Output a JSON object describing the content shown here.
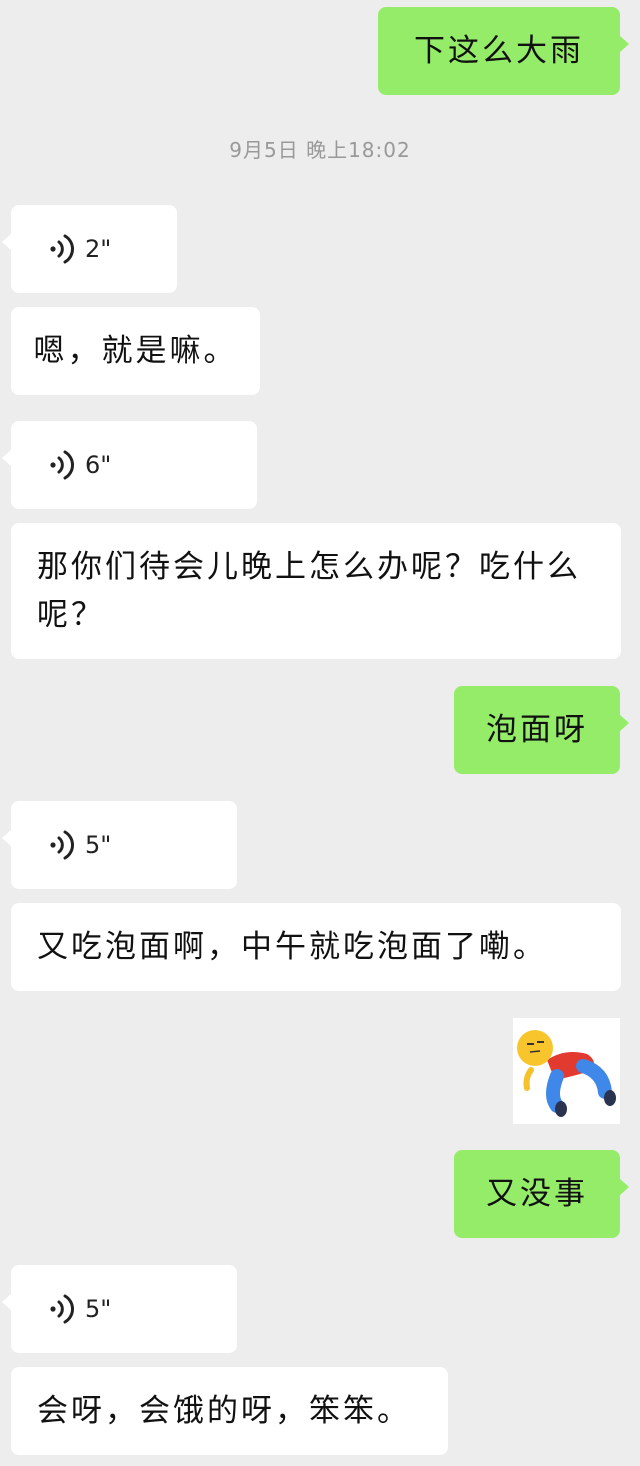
{
  "messages": [
    {
      "side": "right",
      "type": "text",
      "text": "下这么大雨"
    },
    {
      "type": "timestamp",
      "text": "9月5日 晚上18:02"
    },
    {
      "side": "left",
      "type": "voice",
      "duration": "2\""
    },
    {
      "side": "left",
      "type": "text",
      "text": "嗯，就是嘛。"
    },
    {
      "side": "left",
      "type": "voice",
      "duration": "6\""
    },
    {
      "side": "left",
      "type": "text",
      "text": "那你们待会儿晚上怎么办呢？吃什么呢？"
    },
    {
      "side": "right",
      "type": "text",
      "text": "泡面呀"
    },
    {
      "side": "left",
      "type": "voice",
      "duration": "5\""
    },
    {
      "side": "left",
      "type": "text",
      "text": "又吃泡面啊，中午就吃泡面了嘞。"
    },
    {
      "side": "right",
      "type": "sticker",
      "sticker": "lying-down-emoji-sticker"
    },
    {
      "side": "right",
      "type": "text",
      "text": "又没事"
    },
    {
      "side": "left",
      "type": "voice",
      "duration": "5\""
    },
    {
      "side": "left",
      "type": "text",
      "text": "会呀，会饿的呀，笨笨。"
    }
  ],
  "colors": {
    "background": "#ededed",
    "bubble_left": "#ffffff",
    "bubble_right": "#95ec69",
    "timestamp": "#999999"
  }
}
